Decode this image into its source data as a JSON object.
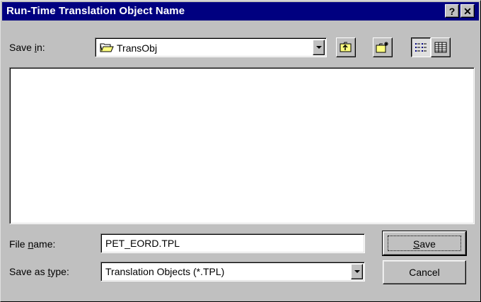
{
  "window": {
    "title": "Run-Time Translation Object Name",
    "help_button": "?",
    "close_button": "✕"
  },
  "save_in": {
    "label_pre": "Save ",
    "label_key": "i",
    "label_post": "n:",
    "folder": "TransObj"
  },
  "toolbar": {
    "up_one_level": "up-folder-icon",
    "new_folder": "new-folder-icon",
    "list_view": "list-view-icon",
    "details_view": "details-view-icon"
  },
  "file_name": {
    "label_pre": "File ",
    "label_key": "n",
    "label_post": "ame:",
    "value": "PET_EORD.TPL"
  },
  "save_as_type": {
    "label_pre": "Save as ",
    "label_key": "t",
    "label_post": "ype:",
    "value": "Translation Objects (*.TPL)"
  },
  "buttons": {
    "save_key": "S",
    "save_rest": "ave",
    "cancel": "Cancel"
  }
}
